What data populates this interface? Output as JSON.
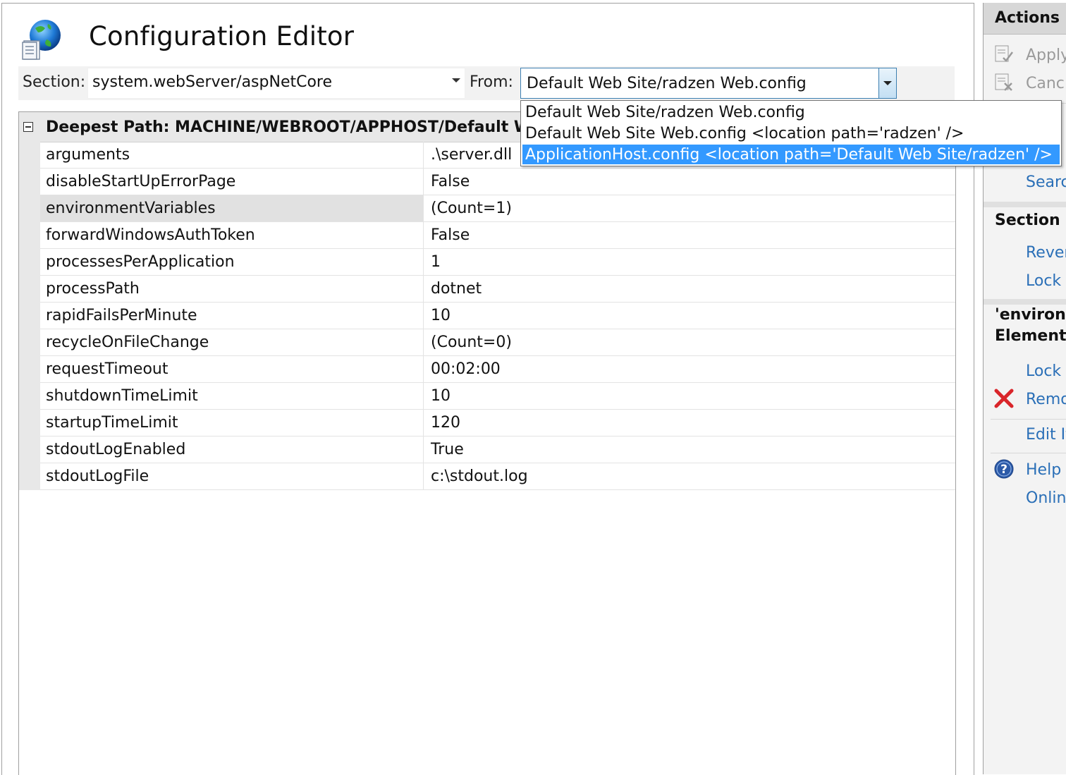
{
  "header": {
    "title": "Configuration Editor"
  },
  "toolbar": {
    "section_label": "Section:",
    "section_value": "system.webServer/aspNetCore",
    "from_label": "From:",
    "from_value": "Default Web Site/radzen Web.config",
    "from_options": [
      "Default Web Site/radzen Web.config",
      "Default Web Site Web.config <location path='radzen' />",
      "ApplicationHost.config <location path='Default Web Site/radzen' />"
    ],
    "from_highlighted_index": 2
  },
  "grid": {
    "header": "Deepest Path: MACHINE/WEBROOT/APPHOST/Default Web",
    "rows": [
      {
        "name": "arguments",
        "value": ".\\server.dll"
      },
      {
        "name": "disableStartUpErrorPage",
        "value": "False"
      },
      {
        "name": "environmentVariables",
        "value": "(Count=1)"
      },
      {
        "name": "forwardWindowsAuthToken",
        "value": "False"
      },
      {
        "name": "processesPerApplication",
        "value": "1"
      },
      {
        "name": "processPath",
        "value": "dotnet"
      },
      {
        "name": "rapidFailsPerMinute",
        "value": "10"
      },
      {
        "name": "recycleOnFileChange",
        "value": "(Count=0)"
      },
      {
        "name": "requestTimeout",
        "value": "00:02:00"
      },
      {
        "name": "shutdownTimeLimit",
        "value": "10"
      },
      {
        "name": "startupTimeLimit",
        "value": "120"
      },
      {
        "name": "stdoutLogEnabled",
        "value": "True"
      },
      {
        "name": "stdoutLogFile",
        "value": "c:\\stdout.log"
      }
    ],
    "selected_row": "environmentVariables"
  },
  "actions": {
    "title": "Actions",
    "apply": "Apply",
    "cancel": "Canc",
    "search": "Searc",
    "section_heading": "Section",
    "revert": "Rever",
    "lock_section": "Lock",
    "element_heading_1": "'environn",
    "element_heading_2": "Element",
    "lock_element": "Lock",
    "remove": "Remo",
    "edit_items": "Edit It",
    "help": "Help",
    "online": "Onlin"
  },
  "colors": {
    "link": "#2a6fb7",
    "highlight": "#3399ff",
    "remove_icon": "#d9252a",
    "help_icon": "#2c5aa8"
  }
}
